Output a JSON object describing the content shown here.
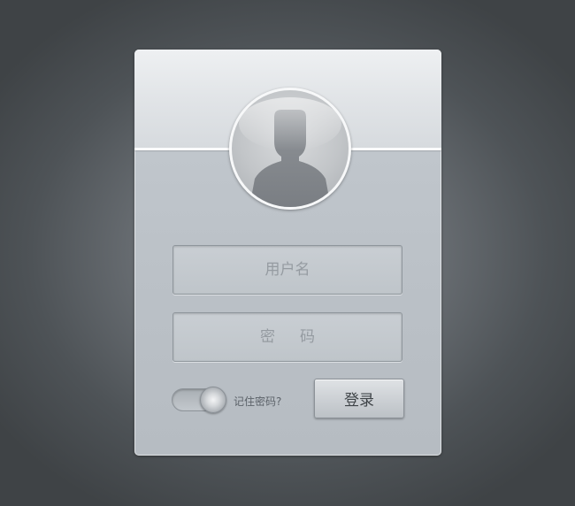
{
  "login": {
    "username": {
      "value": "",
      "placeholder": "用户名"
    },
    "password": {
      "value": "",
      "placeholder": "密码"
    },
    "remember": {
      "label": "记住密码?",
      "toggled": true
    },
    "submit_label": "登录"
  },
  "icons": {
    "avatar": "user-silhouette-icon"
  },
  "colors": {
    "background": "#4e5357",
    "card": "#bbc1c7",
    "header": "#e6e9ec"
  }
}
